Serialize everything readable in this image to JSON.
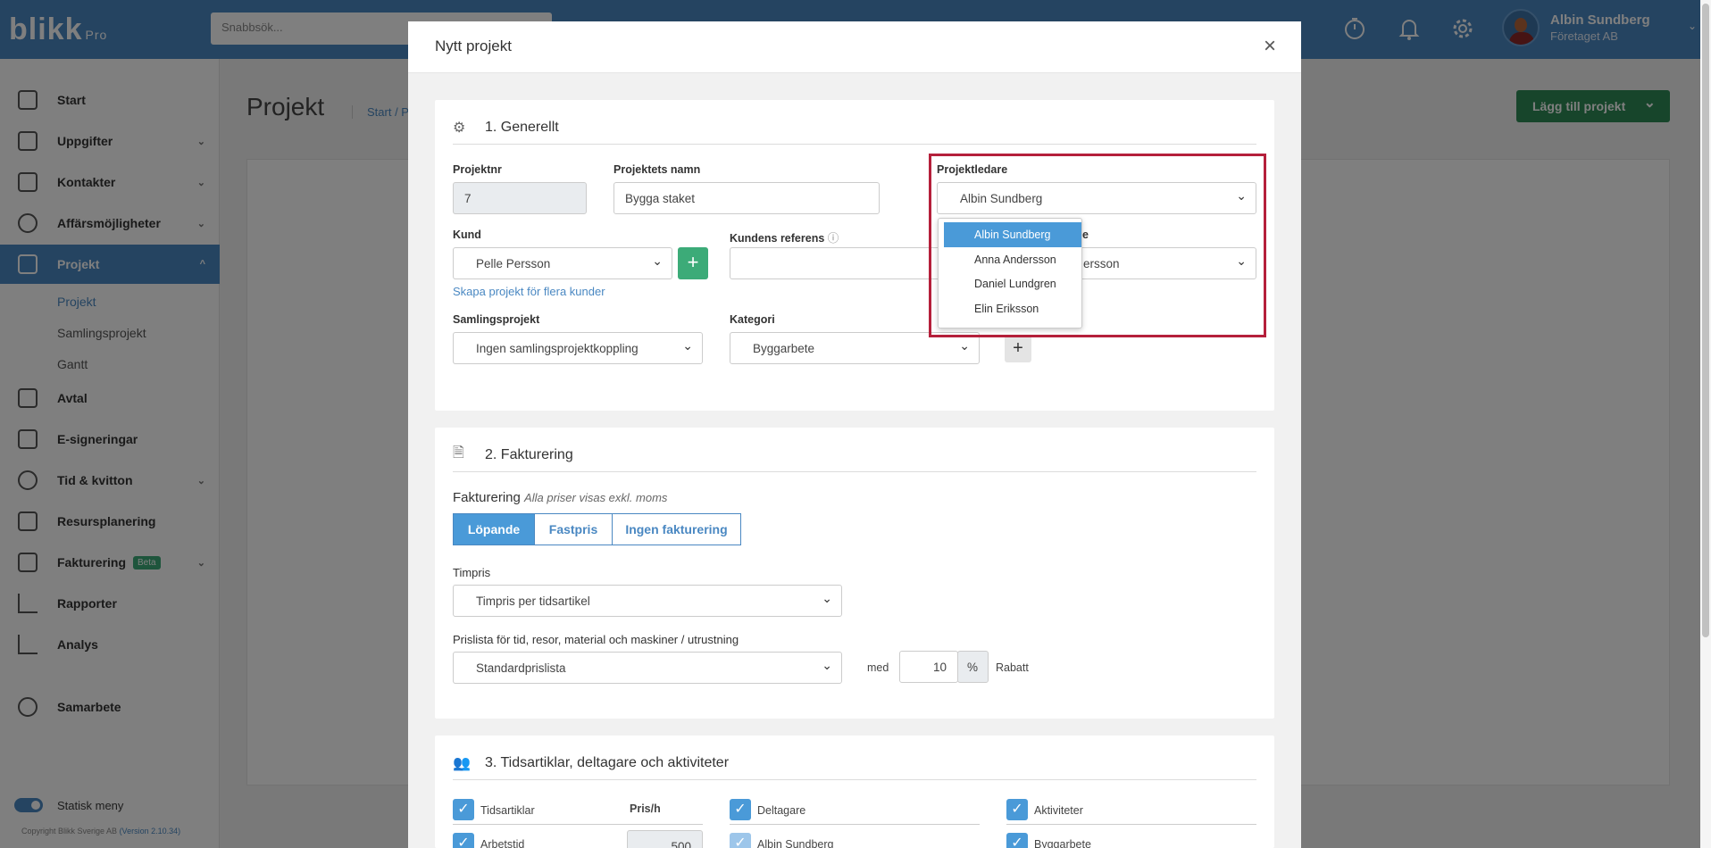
{
  "app": {
    "logo": "blikk",
    "logo_suffix": "Pro",
    "search_placeholder": "Snabbsök..."
  },
  "user": {
    "name": "Albin Sundberg",
    "company": "Företaget AB"
  },
  "sidebar": {
    "items": [
      {
        "label": "Start",
        "icon": "home-icon"
      },
      {
        "label": "Uppgifter",
        "icon": "checkbox-icon"
      },
      {
        "label": "Kontakter",
        "icon": "contacts-icon"
      },
      {
        "label": "Affärsmöjligheter",
        "icon": "dollar-icon"
      },
      {
        "label": "Projekt",
        "icon": "table-icon"
      },
      {
        "label": "Avtal",
        "icon": "document-icon"
      },
      {
        "label": "E-signeringar",
        "icon": "signature-icon"
      },
      {
        "label": "Tid & kvitton",
        "icon": "clock-icon"
      },
      {
        "label": "Resursplanering",
        "icon": "calendar-icon"
      },
      {
        "label": "Fakturering",
        "icon": "invoice-icon",
        "badge": "Beta"
      },
      {
        "label": "Rapporter",
        "icon": "bar-chart-icon"
      },
      {
        "label": "Analys",
        "icon": "analysis-icon"
      },
      {
        "label": "Samarbete",
        "icon": "share-icon"
      }
    ],
    "subitems": [
      "Projekt",
      "Samlingsprojekt",
      "Gantt"
    ],
    "toggle_label": "Statisk meny",
    "copyright": "Copyright Blikk Sverige AB",
    "version": "(Version 2.10.34)"
  },
  "page": {
    "title": "Projekt",
    "breadcrumb": "Start / P",
    "add_button": "Lägg till projekt"
  },
  "modal": {
    "title": "Nytt projekt",
    "section1": {
      "title": "1. Generellt",
      "projektnr_label": "Projektnr",
      "projektnr_value": "7",
      "namn_label": "Projektets namn",
      "namn_value": "Bygga staket",
      "projektledare_label": "Projektledare",
      "projektledare_value": "Albin Sundberg",
      "kund_label": "Kund",
      "kund_value": "Pelle Persson",
      "kund_link": "Skapa projekt för flera kunder",
      "kundref_label": "Kundens referens",
      "partial_label": "e",
      "partial_value": "ersson",
      "samlings_label": "Samlingsprojekt",
      "samlings_value": "Ingen samlingsprojektkoppling",
      "kategori_label": "Kategori",
      "kategori_value": "Byggarbete",
      "dropdown_options": [
        "Albin Sundberg",
        "Anna Andersson",
        "Daniel Lundgren",
        "Elin Eriksson"
      ]
    },
    "section2": {
      "title": "2. Fakturering",
      "fakt_label": "Fakturering",
      "fakt_note": "Alla priser visas exkl. moms",
      "seg": [
        "Löpande",
        "Fastpris",
        "Ingen fakturering"
      ],
      "timpris_label": "Timpris",
      "timpris_value": "Timpris per tidsartikel",
      "prislista_label": "Prislista för tid, resor, material och maskiner / utrustning",
      "prislista_value": "Standardprislista",
      "med": "med",
      "rabatt_value": "10",
      "pct": "%",
      "rabatt": "Rabatt"
    },
    "section3": {
      "title": "3. Tidsartiklar, deltagare och aktiviteter",
      "col1": "Tidsartiklar",
      "col1b": "Pris/h",
      "col2": "Deltagare",
      "col3": "Aktiviteter",
      "row1a": "Arbetstid",
      "row1b": "500",
      "row2": "Albin Sundberg",
      "row3": "Byggarbete"
    }
  },
  "colors": {
    "brand": "#4a88c2",
    "green": "#2e8b57",
    "highlight": "#b5203b"
  }
}
